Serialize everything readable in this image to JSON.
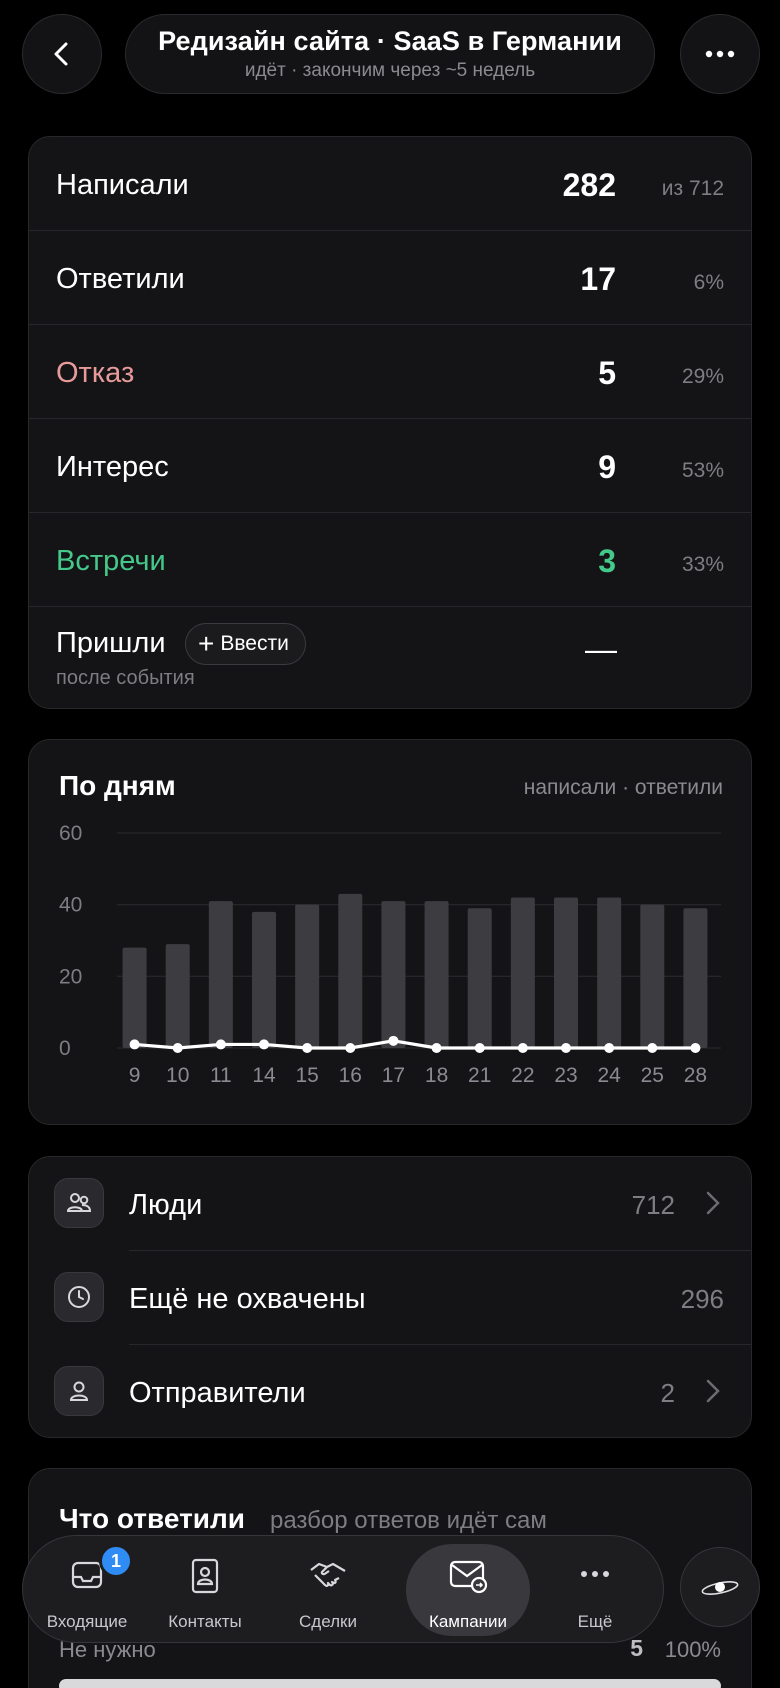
{
  "header": {
    "title": "Редизайн сайта · SaaS в Германии",
    "subtitle": "идёт · закончим через ~5 недель",
    "back_icon": "chevron-left-icon",
    "more_icon": "more-horizontal-icon"
  },
  "funnel": {
    "rows": [
      {
        "label": "Написали",
        "value": "282",
        "pct": "из 712"
      },
      {
        "label": "Ответили",
        "value": "17",
        "pct": "6%"
      },
      {
        "label": "Отказ",
        "value": "5",
        "pct": "29%"
      },
      {
        "label": "Интерес",
        "value": "9",
        "pct": "53%"
      },
      {
        "label": "Встречи",
        "value": "3",
        "pct": "33%"
      }
    ],
    "last": {
      "label": "Пришли",
      "sublabel": "после события",
      "button": "Ввести",
      "value": "—"
    },
    "colors": {
      "refusal": "#e89a9a",
      "meetings": "#45c98a"
    }
  },
  "chart_data": {
    "type": "bar",
    "title": "По дням",
    "legend_text": "написали · ответили",
    "ylim": [
      0,
      60
    ],
    "yticks": [
      "60",
      "40",
      "20",
      "0"
    ],
    "categories": [
      "9",
      "10",
      "11",
      "14",
      "15",
      "16",
      "17",
      "18",
      "21",
      "22",
      "23",
      "24",
      "25",
      "28"
    ],
    "series": [
      {
        "name": "написали",
        "kind": "bar",
        "color": "#3d3d41",
        "values": [
          28,
          29,
          41,
          38,
          40,
          43,
          41,
          41,
          39,
          42,
          42,
          42,
          40,
          39
        ]
      },
      {
        "name": "ответили",
        "kind": "line",
        "color": "#ffffff",
        "values": [
          1,
          0,
          1,
          1,
          0,
          0,
          2,
          0,
          0,
          0,
          0,
          0,
          0,
          0
        ]
      }
    ],
    "grid": true
  },
  "lists": [
    {
      "label": "Люди",
      "count": "712",
      "icon": "people-icon",
      "chevron": true
    },
    {
      "label": "Ещё не охвачены",
      "count": "296",
      "icon": "clock-icon",
      "chevron": false
    },
    {
      "label": "Отправители",
      "count": "2",
      "icon": "user-icon",
      "chevron": true
    }
  ],
  "replies": {
    "title": "Что ответили",
    "subtitle": "разбор ответов идёт сам",
    "row_label": "Не нужно",
    "row_value": "5",
    "row_pct": "100%"
  },
  "nav": {
    "items": [
      {
        "label": "Входящие",
        "icon": "inbox-icon",
        "badge": "1"
      },
      {
        "label": "Контакты",
        "icon": "contacts-icon"
      },
      {
        "label": "Сделки",
        "icon": "handshake-icon"
      },
      {
        "label": "Кампании",
        "icon": "campaign-mail-icon",
        "active": true
      },
      {
        "label": "Ещё",
        "icon": "more-horizontal-icon"
      }
    ],
    "fab_icon": "planet-icon"
  }
}
